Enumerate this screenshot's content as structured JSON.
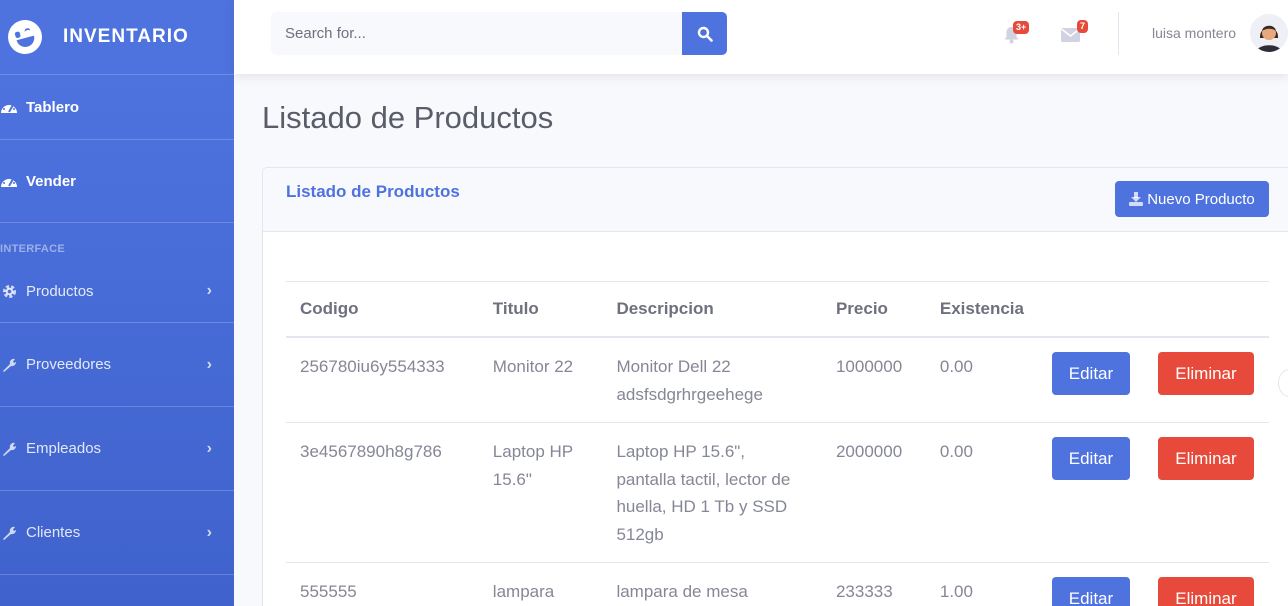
{
  "brand": {
    "name": "INVENTARIO"
  },
  "sidebar": {
    "items": [
      {
        "label": "Tablero",
        "icon": "tachometer-icon"
      },
      {
        "label": "Vender",
        "icon": "tachometer-icon"
      }
    ],
    "heading": "INTERFACE",
    "groups": [
      {
        "label": "Productos",
        "icon": "gear-icon"
      },
      {
        "label": "Proveedores",
        "icon": "wrench-icon"
      },
      {
        "label": "Empleados",
        "icon": "wrench-icon"
      },
      {
        "label": "Clientes",
        "icon": "wrench-icon"
      }
    ]
  },
  "topbar": {
    "search_placeholder": "Search for...",
    "alerts_badge": "3+",
    "messages_badge": "7",
    "username": "luisa montero"
  },
  "page": {
    "title": "Listado de Productos",
    "card_title": "Listado de Productos",
    "new_button": "Nuevo Producto"
  },
  "table": {
    "headers": [
      "Codigo",
      "Titulo",
      "Descripcion",
      "Precio",
      "Existencia"
    ],
    "rows": [
      {
        "codigo": "256780iu6y554333",
        "titulo": "Monitor 22",
        "descripcion": "Monitor Dell 22 adsfsdgrhrgeehege",
        "precio": "1000000",
        "existencia": "0.00"
      },
      {
        "codigo": "3e4567890h8g786",
        "titulo": "Laptop HP 15.6\"",
        "descripcion": "Laptop HP 15.6\", pantalla tactil, lector de huella, HD 1 Tb y SSD 512gb",
        "precio": "2000000",
        "existencia": "0.00"
      },
      {
        "codigo": "555555",
        "titulo": "lampara",
        "descripcion": "lampara de mesa",
        "precio": "233333",
        "existencia": "1.00"
      }
    ],
    "edit_label": "Editar",
    "delete_label": "Eliminar"
  },
  "colors": {
    "primary": "#4e73df",
    "danger": "#e74a3b"
  }
}
